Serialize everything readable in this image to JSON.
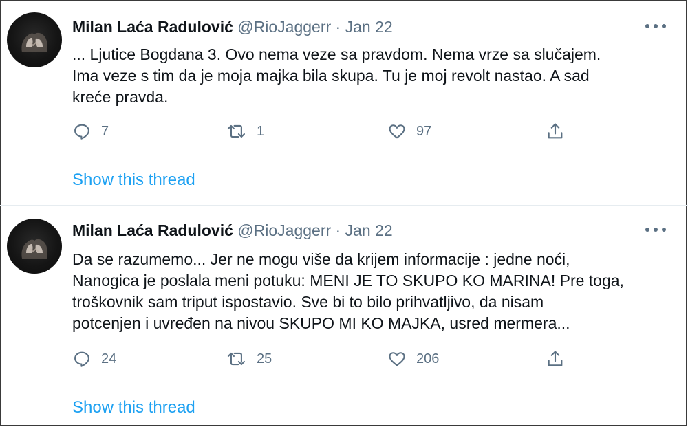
{
  "tweets": [
    {
      "author_name": "Milan Laća Radulović",
      "handle": "@RioJaggerr",
      "separator": "·",
      "date": "Jan 22",
      "text_lines": [
        "... Ljutice Bogdana 3. Ovo nema veze sa pravdom. Nema vrze sa slučajem.",
        "Ima veze s tim da je moja majka bila skupa. Tu je moj revolt nastao. A sad",
        "kreće pravda."
      ],
      "replies": "7",
      "retweets": "1",
      "likes": "97",
      "thread_link": "Show this thread"
    },
    {
      "author_name": "Milan Laća Radulović",
      "handle": "@RioJaggerr",
      "separator": "·",
      "date": "Jan 22",
      "text_lines": [
        "Da se razumemo... Jer ne mogu više da krijem informacije : jedne noći,",
        "Nanogica je poslala meni potuku: MENI JE TO SKUPO KO MARINA! Pre toga,",
        "troškovnik sam triput ispostavio. Sve bi to bilo prihvatljivo, da nisam",
        "potcenjen i uvređen na nivou SKUPO MI KO MAJKA, usred mermera..."
      ],
      "replies": "24",
      "retweets": "25",
      "likes": "206",
      "thread_link": "Show this thread"
    }
  ],
  "icons": {
    "reply": "reply-icon",
    "retweet": "retweet-icon",
    "like": "heart-icon",
    "share": "share-icon",
    "more": "more-options-icon"
  },
  "colors": {
    "text": "#0f1419",
    "secondary": "#5b7083",
    "link": "#1da1f2",
    "divider": "#e6ecf0"
  }
}
